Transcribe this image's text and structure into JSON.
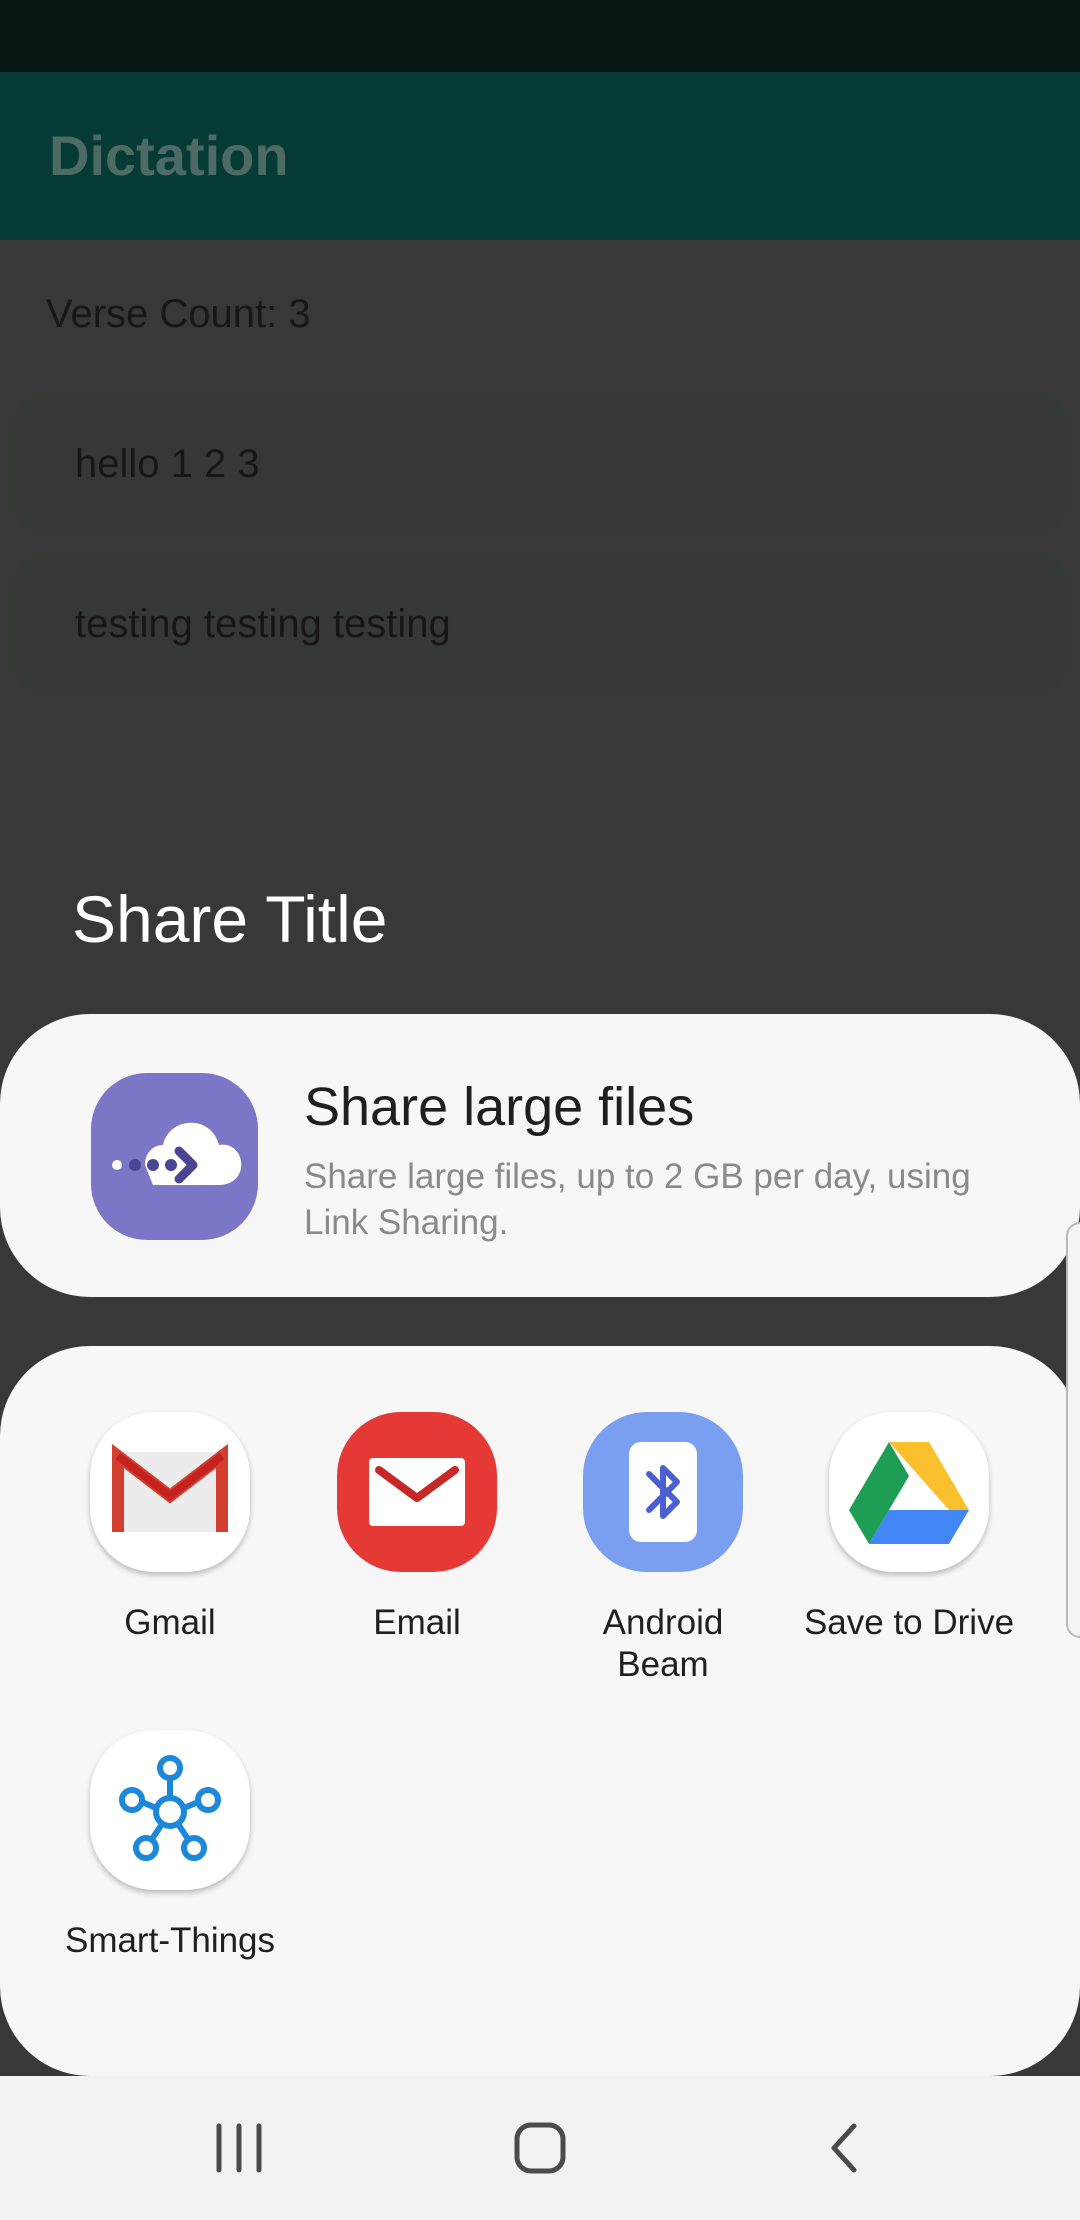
{
  "app": {
    "title": "Dictation",
    "verse_count": "Verse Count: 3",
    "verses": [
      "hello 1 2 3",
      "testing testing testing"
    ]
  },
  "share_sheet": {
    "title": "Share Title",
    "large_files": {
      "title": "Share large files",
      "description": "Share large files, up to 2 GB per day, using Link Sharing.",
      "icon": "cloud-link-icon"
    },
    "apps": [
      {
        "label": "Gmail",
        "icon": "gmail-icon"
      },
      {
        "label": "Email",
        "icon": "email-icon"
      },
      {
        "label": "Android Beam",
        "icon": "bluetooth-icon"
      },
      {
        "label": "Save to Drive",
        "icon": "drive-icon"
      },
      {
        "label": "Smart-Things",
        "icon": "smartthings-icon"
      }
    ]
  },
  "nav_bar": {
    "buttons": [
      "recent-apps-icon",
      "home-icon",
      "back-icon"
    ]
  },
  "colors": {
    "app_bar": "#053b34",
    "scrim": "#383838",
    "sheet_background": "#f7f7f7",
    "link_sharing_purple": "#7b76c6",
    "email_red": "#e53935",
    "beam_blue": "#7b9ff0"
  }
}
